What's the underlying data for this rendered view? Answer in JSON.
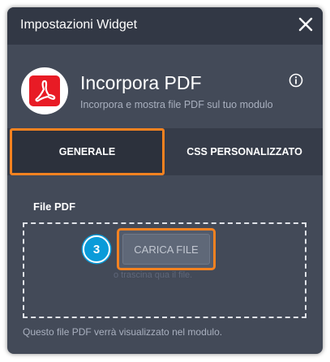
{
  "header": {
    "title": "Impostazioni Widget",
    "close_icon": "close-icon"
  },
  "app": {
    "name": "Incorpora PDF",
    "description": "Incorpora e mostra file PDF sul tuo modulo",
    "icon": "pdf-icon",
    "info_icon": "info-icon"
  },
  "tabs": [
    {
      "label": "GENERALE",
      "active": true
    },
    {
      "label": "CSS PERSONALIZZATO",
      "active": false
    }
  ],
  "upload": {
    "label": "File PDF",
    "button_label": "CARICA FILE",
    "drag_hint": "o trascina qua il file.",
    "step_number": "3"
  },
  "footer": {
    "note": "Questo file PDF verrà visualizzato nel modulo."
  },
  "colors": {
    "accent": "#f58220",
    "badge": "#0a9bd9",
    "pdf_red": "#e81b25"
  }
}
